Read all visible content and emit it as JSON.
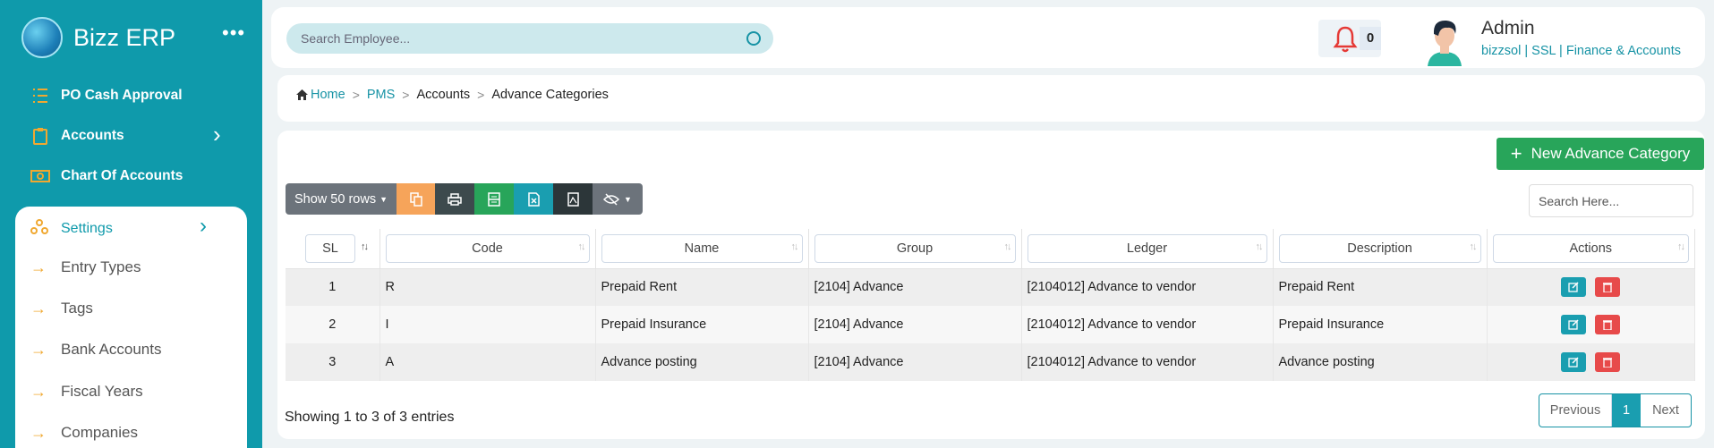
{
  "sidebar": {
    "brand": "Bizz ERP",
    "menu_dots": "•••",
    "items": [
      {
        "label": "PO Cash Approval",
        "icon": "list-icon"
      },
      {
        "label": "Accounts",
        "icon": "clipboard-icon"
      },
      {
        "label": "Chart Of Accounts",
        "icon": "money-icon"
      }
    ],
    "panel": {
      "settings_label": "Settings",
      "items": [
        "Entry Types",
        "Tags",
        "Bank Accounts",
        "Fiscal Years",
        "Companies"
      ]
    }
  },
  "topbar": {
    "search_placeholder": "Search Employee...",
    "notification_count": "0",
    "user_name": "Admin",
    "user_org": "bizzsol | SSL  | Finance & Accounts"
  },
  "breadcrumb": {
    "home": "Home",
    "pms": "PMS",
    "accounts": "Accounts",
    "current": "Advance Categories"
  },
  "actions": {
    "new_button": "New Advance Category"
  },
  "toolbar": {
    "show_rows": "Show 50 rows",
    "search_placeholder": "Search Here..."
  },
  "table": {
    "headers": [
      "SL",
      "Code",
      "Name",
      "Group",
      "Ledger",
      "Description",
      "Actions"
    ],
    "rows": [
      {
        "sl": "1",
        "code": "R",
        "name": "Prepaid Rent",
        "group": "[2104] Advance",
        "ledger": "[2104012] Advance to vendor",
        "description": "Prepaid Rent"
      },
      {
        "sl": "2",
        "code": "I",
        "name": "Prepaid Insurance",
        "group": "[2104] Advance",
        "ledger": "[2104012] Advance to vendor",
        "description": "Prepaid Insurance"
      },
      {
        "sl": "3",
        "code": "A",
        "name": "Advance posting",
        "group": "[2104] Advance",
        "ledger": "[2104012] Advance to vendor",
        "description": "Advance posting"
      }
    ]
  },
  "footer": {
    "showing": "Showing 1 to 3 of 3 entries",
    "prev": "Previous",
    "page": "1",
    "next": "Next"
  },
  "colors": {
    "sidebar": "#0f9aab",
    "accent": "#1793a5",
    "success": "#28a55a",
    "danger": "#e74a4a"
  }
}
